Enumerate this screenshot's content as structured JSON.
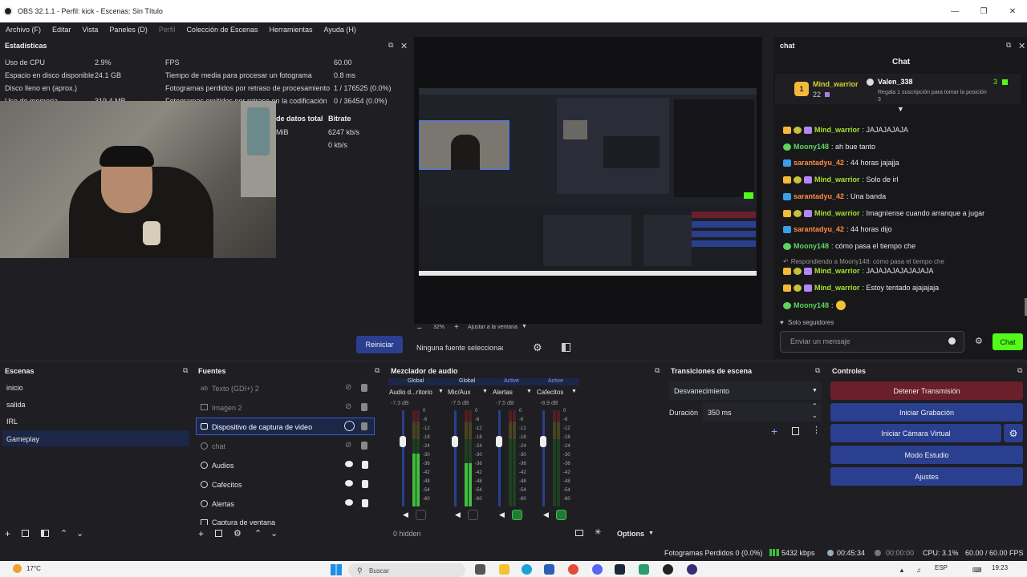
{
  "window": {
    "title": "OBS 32.1.1 - Perfil: kick - Escenas: Sin Título"
  },
  "menu": [
    "Archivo (F)",
    "Editar",
    "Vista",
    "Paneles (D)",
    "Perfil",
    "Colección de Escenas",
    "Herramientas",
    "Ayuda (H)"
  ],
  "stats": {
    "title": "Estadísticas",
    "rows": [
      {
        "label": "Uso de CPU",
        "value": "2.9%",
        "label2": "FPS",
        "value2": "60.00"
      },
      {
        "label": "Espacio en disco disponible",
        "value": "24.1 GB",
        "label2": "Tiempo de media para procesar un fotograma",
        "value2": "0.8 ms"
      },
      {
        "label": "Disco lleno en (aprox.)",
        "value": "",
        "label2": "Fotogramas perdidos por retraso de procesamiento",
        "value2": "1 / 176525 (0.0%)"
      },
      {
        "label": "Uso de memoria",
        "value": "319.4 MB",
        "label2": "Fotogramas omitidos por retraso en la codificación",
        "value2": "0 / 36454 (0.0%)"
      }
    ],
    "data_total_header": "de datos total",
    "bitrate_header": "Bitrate",
    "data_row1": "MiB",
    "bitrate_row1": "6247 kb/s",
    "bitrate_row2": "0 kb/s",
    "reset_button": "Reiniciar"
  },
  "preview": {
    "zoom": "32%",
    "fit_label": "Ajustar a la ventana",
    "no_source": "Ninguna fuente seleccionada"
  },
  "chat": {
    "dock_title": "chat",
    "header": "Chat",
    "pinned": {
      "user1": "Mind_warrior",
      "count1": "22",
      "user2": "Valen_338",
      "message": "Regala 1 suscripción para tomar la posición 3",
      "count2": "3"
    },
    "messages": [
      {
        "user": "Mind_warrior",
        "text": ": JAJAJAJAJA",
        "color": "#a6e22e",
        "badges": true
      },
      {
        "user": "Moony148",
        "text": ": ah bue tanto",
        "color": "#5cd65c",
        "badges": false
      },
      {
        "user": "sarantadyu_42",
        "text": ": 44 horas jajajja",
        "color": "#ff8c42",
        "badges": false
      },
      {
        "user": "Mind_warrior",
        "text": ": Solo de irl",
        "color": "#a6e22e",
        "badges": true
      },
      {
        "user": "sarantadyu_42",
        "text": ": Una banda",
        "color": "#ff8c42",
        "badges": false
      },
      {
        "user": "Mind_warrior",
        "text": ": Imagnìense cuando arranque a jugar",
        "color": "#a6e22e",
        "badges": true
      },
      {
        "user": "sarantadyu_42",
        "text": ": 44 horas dijo",
        "color": "#ff8c42",
        "badges": false
      },
      {
        "user": "Moony148",
        "text": ": cómo pasa el tiempo che",
        "color": "#5cd65c",
        "badges": false
      },
      {
        "user": "Mind_warrior",
        "text": ": JAJAJAJAJAJAJAJA",
        "color": "#a6e22e",
        "badges": true
      },
      {
        "user": "Mind_warrior",
        "text": ": Estoy tentado ajajajaja",
        "color": "#a6e22e",
        "badges": true
      },
      {
        "user": "Moony148",
        "text": ": ",
        "color": "#5cd65c",
        "badges": false
      }
    ],
    "reply_note": "Respondiendo a Moony148: cómo pasa el tiempo che",
    "followers_only": "Solo seguidores",
    "input_placeholder": "Enviar un mensaje",
    "send_button": "Chat"
  },
  "scenes": {
    "title": "Escenas",
    "items": [
      "inicio",
      "salida",
      "IRL",
      "Gameplay"
    ]
  },
  "sources": {
    "title": "Fuentes",
    "items": [
      {
        "name": "Texto (GDI+) 2",
        "icon": "text-icon",
        "visible": false
      },
      {
        "name": "Imagen 2",
        "icon": "image-icon",
        "visible": false
      },
      {
        "name": "Dispositivo de captura de video",
        "icon": "camera-icon",
        "visible": true
      },
      {
        "name": "chat",
        "icon": "browser-icon",
        "visible": false
      },
      {
        "name": "Audios",
        "icon": "audio-icon",
        "visible": true
      },
      {
        "name": "Cafecitos",
        "icon": "browser-icon",
        "visible": true
      },
      {
        "name": "Alertas",
        "icon": "browser-icon",
        "visible": true
      },
      {
        "name": "Captura de ventana",
        "icon": "window-icon",
        "visible": true
      }
    ]
  },
  "mixer": {
    "title": "Mezclador de audio",
    "channels": [
      {
        "tag": "Global",
        "name": "Audio d...ritorio",
        "db": "-7.3 dB",
        "level": 0.55
      },
      {
        "tag": "Global",
        "name": "Mic/Aux",
        "db": "-7.5 dB",
        "level": 0.45
      },
      {
        "tag": "Active",
        "name": "Alertas",
        "db": "-7.5 dB",
        "level": 0.0
      },
      {
        "tag": "Active",
        "name": "Cafecitos",
        "db": "-8.9 dB",
        "level": 0.0
      }
    ],
    "scale": [
      "0",
      "-6",
      "-12",
      "-18",
      "-24",
      "-30",
      "-36",
      "-42",
      "-48",
      "-54",
      "-60"
    ],
    "hidden": "0 hidden",
    "options": "Options"
  },
  "transitions": {
    "title": "Transiciones de escena",
    "selected": "Desvanecimiento",
    "duration_label": "Duración",
    "duration_value": "350 ms"
  },
  "controls": {
    "title": "Controles",
    "stop_stream": "Detener Transmisión",
    "start_record": "Iniciar Grabación",
    "virtual_cam": "Iniciar Cámara Virtual",
    "studio_mode": "Modo Estudio",
    "settings": "Ajustes"
  },
  "status": {
    "dropped": "Fotogramas Perdidos 0 (0.0%)",
    "bitrate": "5432 kbps",
    "stream_time": "00:45:34",
    "rec_time": "00:00:00",
    "cpu": "CPU: 3.1%",
    "fps": "60.00 / 60.00 FPS"
  },
  "taskbar": {
    "weather": "17°C",
    "search": "Buscar",
    "lang": "ESP",
    "time": "19:23"
  },
  "colors": {
    "accent": "#2a3f8f",
    "stop": "#6a1f2a",
    "chat_send": "#53fc18",
    "green_meter": "#3fbf3f"
  }
}
